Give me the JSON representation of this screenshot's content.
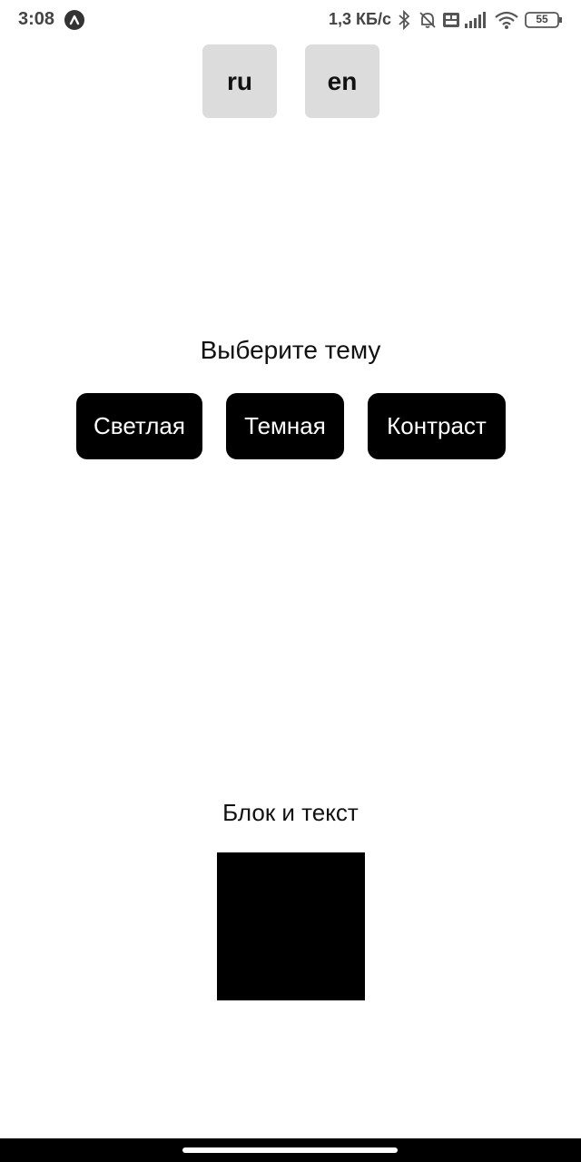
{
  "status_bar": {
    "time": "3:08",
    "network_speed": "1,3 КБ/с",
    "battery_level": "55",
    "icons": [
      "app-icon",
      "bluetooth-icon",
      "mute-bell-icon",
      "volte-icon",
      "signal-icon",
      "wifi-icon",
      "battery-icon"
    ]
  },
  "language": {
    "options": [
      "ru",
      "en"
    ]
  },
  "theme": {
    "title": "Выберите тему",
    "buttons": [
      "Светлая",
      "Темная",
      "Контраст"
    ]
  },
  "demo": {
    "title": "Блок и текст",
    "block_color": "#000000"
  },
  "colors": {
    "background": "#ffffff",
    "lang_button_bg": "#dcdcdc",
    "theme_button_bg": "#000000",
    "theme_button_text": "#ffffff"
  }
}
